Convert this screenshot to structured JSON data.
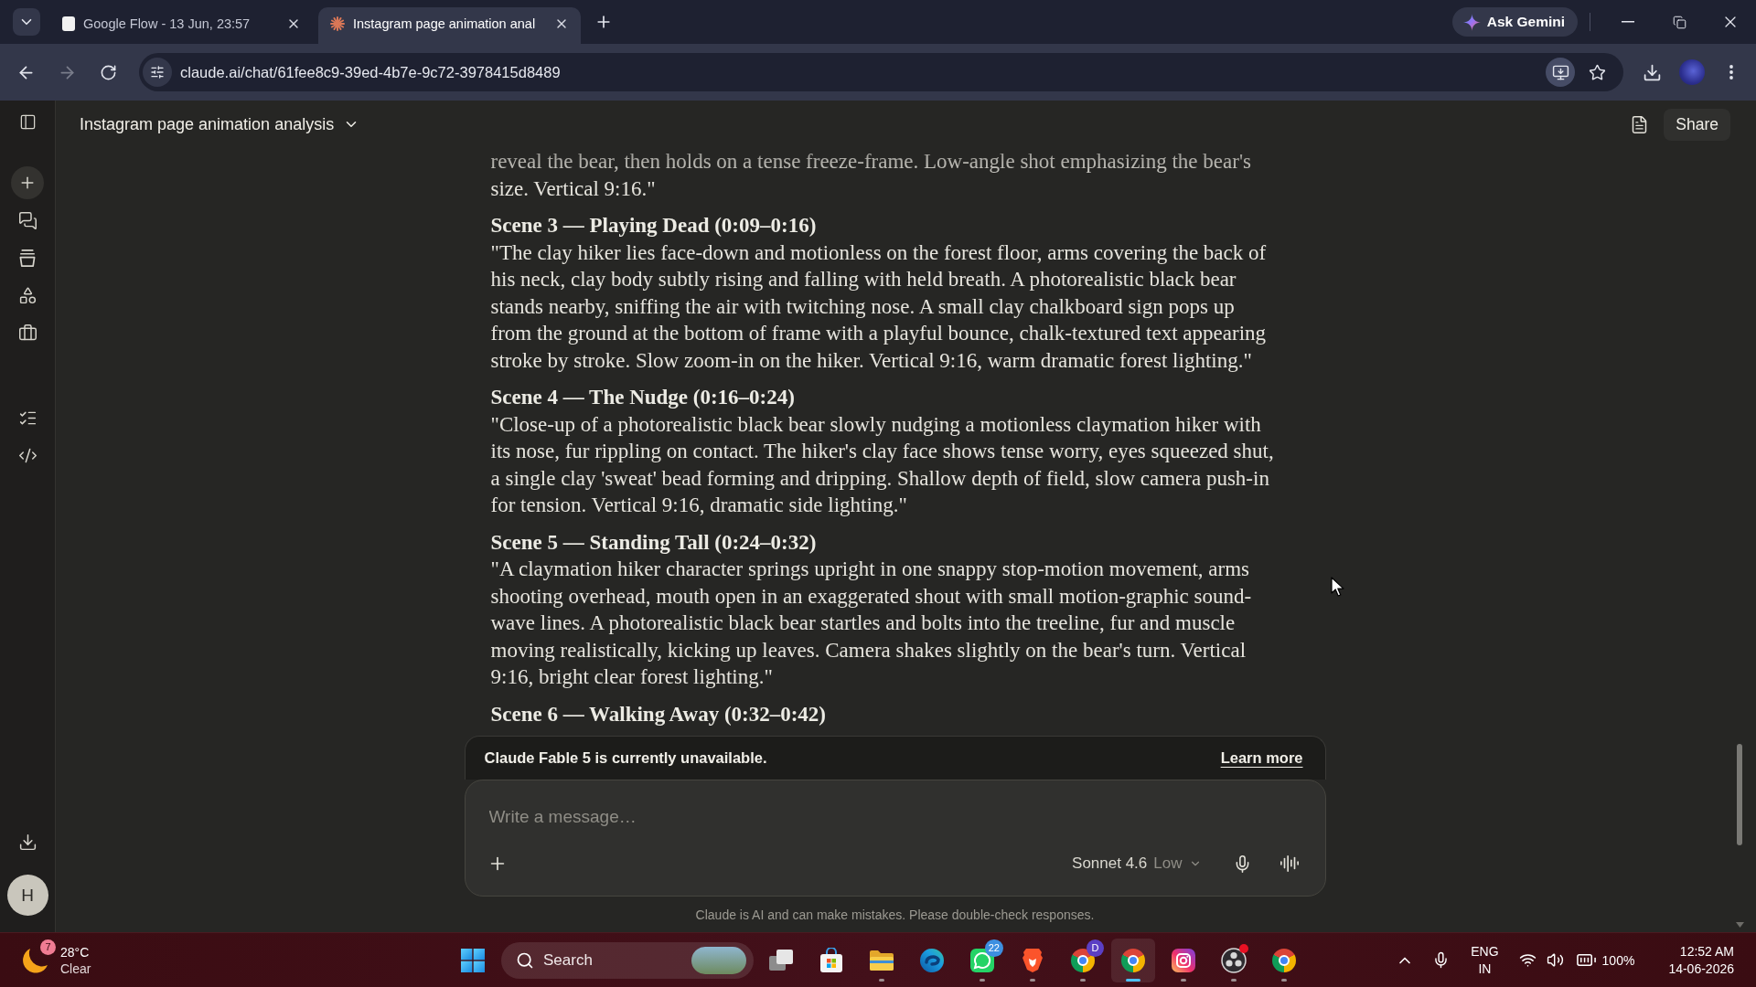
{
  "browser": {
    "tabs": [
      {
        "title": "Google Flow - 13 Jun, 23:57",
        "kind": "document",
        "selected": false
      },
      {
        "title": "Instagram page animation anal",
        "kind": "sparkle",
        "selected": true
      }
    ],
    "assistant_button": "Ask Gemini",
    "navigation": {
      "back_disabled": false,
      "forward_disabled": true
    },
    "address": "claude.ai/chat/61fee8c9-39ed-4b7e-9c72-3978415d8489"
  },
  "sidebar": {
    "avatar": "H"
  },
  "chat": {
    "title": "Instagram page animation analysis",
    "share": "Share",
    "blocks": [
      {
        "kind": "paragraph",
        "text": "reveal the bear, then holds on a tense freeze-frame. Low-angle shot emphasizing the bear's size. Vertical 9:16.\""
      },
      {
        "kind": "heading",
        "text": "Scene 3 — Playing Dead (0:09–0:16)"
      },
      {
        "kind": "paragraph",
        "text": "\"The clay hiker lies face-down and motionless on the forest floor, arms covering the back of his neck, clay body subtly rising and falling with held breath. A photorealistic black bear stands nearby, sniffing the air with twitching nose. A small clay chalkboard sign pops up from the ground at the bottom of frame with a playful bounce, chalk-textured text appearing stroke by stroke. Slow zoom-in on the hiker. Vertical 9:16, warm dramatic forest lighting.\""
      },
      {
        "kind": "heading",
        "text": "Scene 4 — The Nudge (0:16–0:24)"
      },
      {
        "kind": "paragraph",
        "text": "\"Close-up of a photorealistic black bear slowly nudging a motionless claymation hiker with its nose, fur rippling on contact. The hiker's clay face shows tense worry, eyes squeezed shut, a single clay 'sweat' bead forming and dripping. Shallow depth of field, slow camera push-in for tension. Vertical 9:16, dramatic side lighting.\""
      },
      {
        "kind": "heading",
        "text": "Scene 5 — Standing Tall (0:24–0:32)"
      },
      {
        "kind": "paragraph",
        "text": "\"A claymation hiker character springs upright in one snappy stop-motion movement, arms shooting overhead, mouth open in an exaggerated shout with small motion-graphic sound-wave lines. A photorealistic black bear startles and bolts into the treeline, fur and muscle moving realistically, kicking up leaves. Camera shakes slightly on the bear's turn. Vertical 9:16, bright clear forest lighting.\""
      },
      {
        "kind": "heading",
        "text": "Scene 6 — Walking Away (0:32–0:42)"
      }
    ]
  },
  "composer": {
    "notice": "Claude Fable 5 is currently unavailable.",
    "notice_link": "Learn more",
    "placeholder": "Write a message…",
    "model": "Sonnet 4.6",
    "effort": "Low",
    "disclaimer": "Claude is AI and can make mistakes. Please double-check responses."
  },
  "taskbar": {
    "weather": {
      "badge": "7",
      "temperature": "28°C",
      "condition": "Clear"
    },
    "search": "Search",
    "apps": [
      {
        "kind": "task-view",
        "running": false,
        "selected": false,
        "notification": false
      },
      {
        "kind": "store",
        "running": false,
        "selected": false,
        "notification": false
      },
      {
        "kind": "files",
        "running": true,
        "selected": false,
        "notification": false
      },
      {
        "kind": "edge",
        "running": false,
        "selected": false,
        "notification": false
      },
      {
        "kind": "whatsapp",
        "running": true,
        "selected": false,
        "notification": false,
        "badge": "22"
      },
      {
        "kind": "brave",
        "running": true,
        "selected": false,
        "notification": false
      },
      {
        "kind": "chrome",
        "running": true,
        "selected": false,
        "notification": false,
        "badge": "D"
      },
      {
        "kind": "chrome",
        "running": true,
        "selected": true,
        "notification": false
      },
      {
        "kind": "instagram",
        "running": true,
        "selected": false,
        "notification": false
      },
      {
        "kind": "obs",
        "running": true,
        "selected": false,
        "notification": true
      },
      {
        "kind": "chrome",
        "running": true,
        "selected": false,
        "notification": false
      }
    ],
    "tray": {
      "language": "ENG",
      "region": "IN",
      "battery": "100%",
      "time": "12:52 AM",
      "date": "14-06-2026"
    }
  }
}
